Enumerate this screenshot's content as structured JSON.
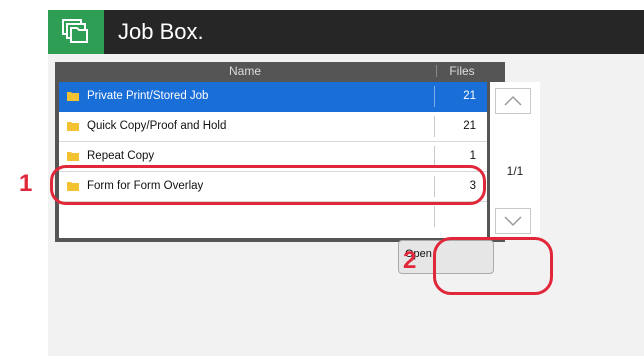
{
  "app": {
    "title": "Job Box.",
    "icon": "job-box-icon"
  },
  "list": {
    "columns": {
      "name": "Name",
      "files": "Files"
    },
    "rows": [
      {
        "name": "Private Print/Stored Job",
        "files": "21",
        "selected": true
      },
      {
        "name": "Quick Copy/Proof and Hold",
        "files": "21",
        "selected": false
      },
      {
        "name": "Repeat Copy",
        "files": "1",
        "selected": false
      },
      {
        "name": "Form for Form Overlay",
        "files": "3",
        "selected": false
      }
    ],
    "page_indicator": "1/1"
  },
  "buttons": {
    "open": "Open"
  },
  "callouts": {
    "one": "1",
    "two": "2"
  },
  "colors": {
    "accent": "#1a6ed8",
    "callout": "#e0283a",
    "title_bar": "#262626",
    "icon_bg": "#2e9e55"
  }
}
